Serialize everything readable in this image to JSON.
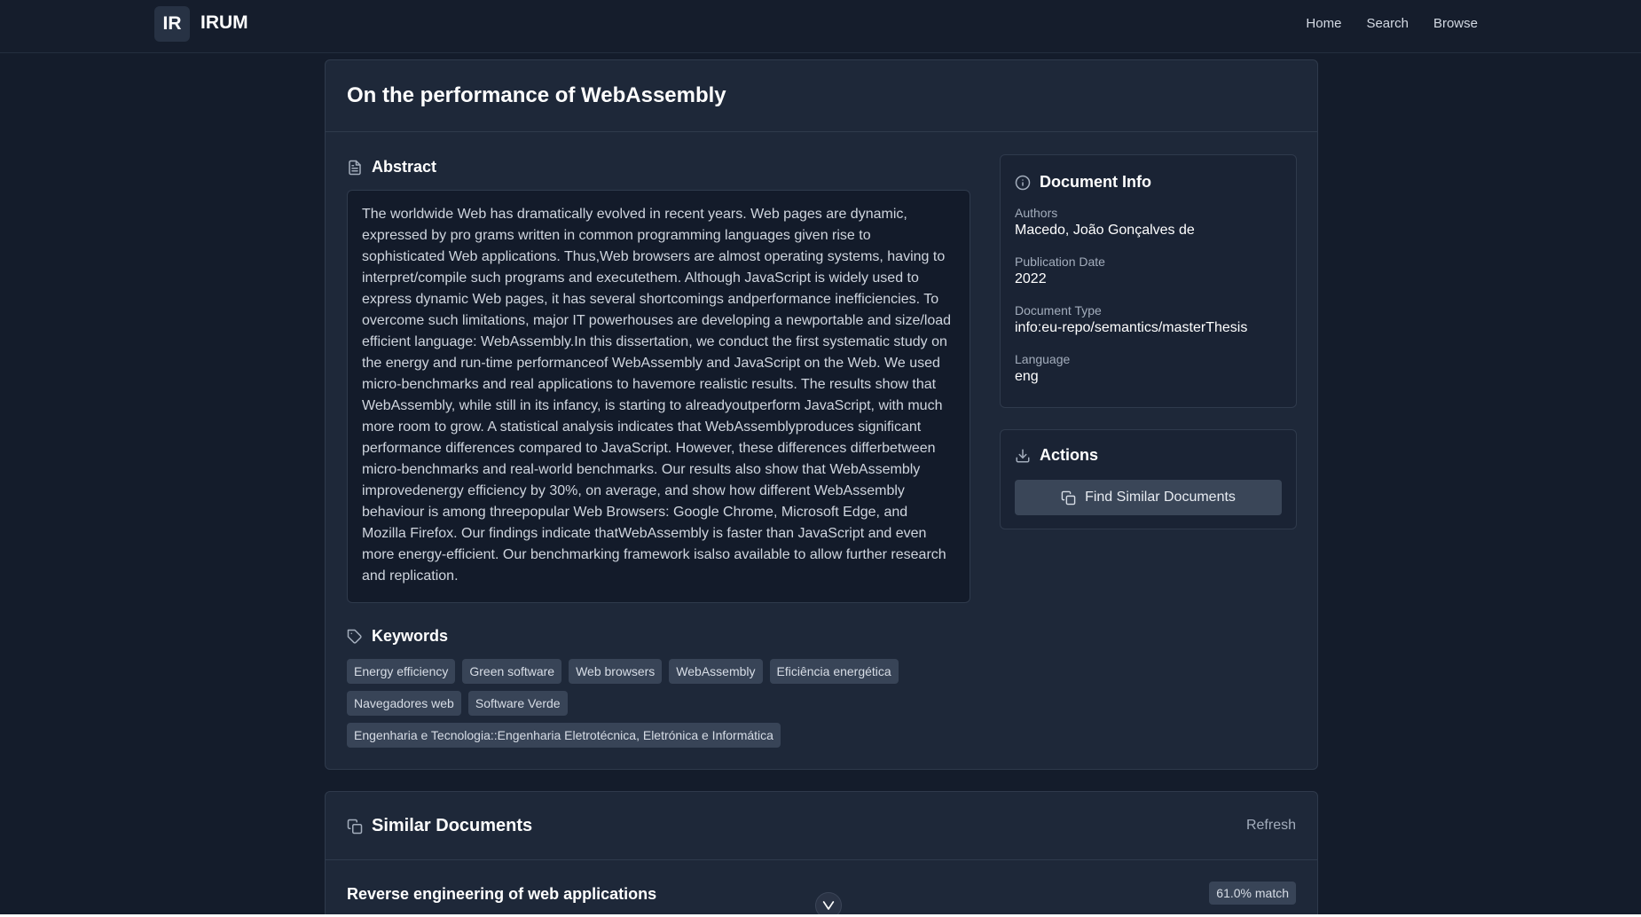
{
  "header": {
    "logo_text": "IR",
    "brand": "IRUM",
    "nav": [
      "Home",
      "Search",
      "Browse"
    ]
  },
  "document": {
    "title": "On the performance of WebAssembly",
    "abstract_heading": "Abstract",
    "abstract": "The worldwide Web has dramatically evolved in recent years. Web pages are dynamic, expressed by pro grams written in common programming languages given rise to sophisticated Web applications. Thus,Web browsers are almost operating systems, having to interpret/compile such programs and executethem. Although JavaScript is widely used to express dynamic Web pages, it has several shortcomings andperformance inefficiencies. To overcome such limitations, major IT powerhouses are developing a newportable and size/load efficient language: WebAssembly.In this dissertation, we conduct the first systematic study on the energy and run-time performanceof WebAssembly and JavaScript on the Web. We used micro-benchmarks and real applications to havemore realistic results. The results show that WebAssembly, while still in its infancy, is starting to alreadyoutperform JavaScript, with much more room to grow. A statistical analysis indicates that WebAssemblyproduces significant performance differences compared to JavaScript. However, these differences differbetween micro-benchmarks and real-world benchmarks. Our results also show that WebAssembly improvedenergy efficiency by 30%, on average, and show how different WebAssembly behaviour is among threepopular Web Browsers: Google Chrome, Microsoft Edge, and Mozilla Firefox. Our findings indicate thatWebAssembly is faster than JavaScript and even more energy-efficient. Our benchmarking framework isalso available to allow further research and replication.",
    "keywords_heading": "Keywords",
    "keywords": [
      "Energy efficiency",
      "Green software",
      "Web browsers",
      "WebAssembly",
      "Eficiência energética",
      "Navegadores web",
      "Software Verde",
      "Engenharia e Tecnologia::Engenharia Eletrotécnica, Eletrónica e Informática"
    ]
  },
  "info": {
    "heading": "Document Info",
    "fields": [
      {
        "label": "Authors",
        "value": "Macedo, João Gonçalves de"
      },
      {
        "label": "Publication Date",
        "value": "2022"
      },
      {
        "label": "Document Type",
        "value": "info:eu-repo/semantics/masterThesis"
      },
      {
        "label": "Language",
        "value": "eng"
      }
    ]
  },
  "actions": {
    "heading": "Actions",
    "find_similar": "Find Similar Documents"
  },
  "similar": {
    "heading": "Similar Documents",
    "refresh": "Refresh",
    "results": [
      {
        "title": "Reverse engineering of web applications",
        "match": "61.0% match"
      }
    ]
  },
  "icons": {
    "abstract": "document-icon",
    "keywords": "tag-icon",
    "info": "info-icon",
    "actions": "download-icon",
    "similar": "copy-icon"
  },
  "colors": {
    "background": "#141c2b",
    "card": "#1e2839",
    "chip": "#384457"
  }
}
